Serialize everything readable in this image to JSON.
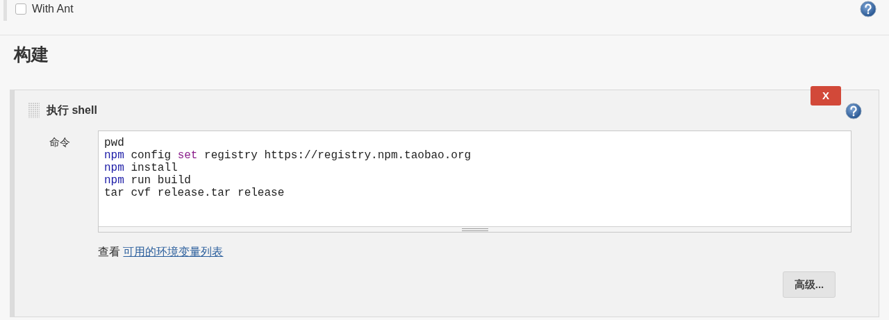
{
  "option": {
    "label": "With Ant",
    "checked": false
  },
  "section": {
    "title": "构建"
  },
  "build_step": {
    "title": "执行 shell",
    "delete_label": "X",
    "command_label": "命令",
    "command_lines": [
      [
        {
          "kind": "plain",
          "text": "pwd"
        }
      ],
      [
        {
          "kind": "keyword",
          "text": "npm"
        },
        {
          "kind": "plain",
          "text": " config "
        },
        {
          "kind": "builtin",
          "text": "set"
        },
        {
          "kind": "plain",
          "text": " registry https://registry.npm.taobao.org"
        }
      ],
      [
        {
          "kind": "keyword",
          "text": "npm"
        },
        {
          "kind": "plain",
          "text": " install"
        }
      ],
      [
        {
          "kind": "keyword",
          "text": "npm"
        },
        {
          "kind": "plain",
          "text": " run build"
        }
      ],
      [
        {
          "kind": "plain",
          "text": "tar cvf release.tar release"
        }
      ]
    ],
    "env_prefix": "查看",
    "env_link": "可用的环境变量列表",
    "advanced_button": "高级..."
  }
}
